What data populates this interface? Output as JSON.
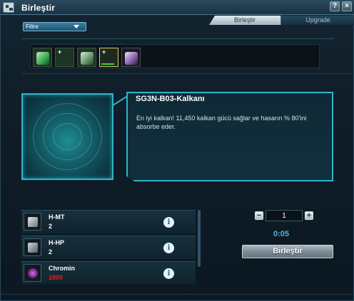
{
  "window": {
    "title": "Birleştir"
  },
  "titlebar": {
    "help_label": "?",
    "close_label": "×"
  },
  "tabs": [
    {
      "label": "Birleştir",
      "active": true
    },
    {
      "label": "Upgrade",
      "active": false
    }
  ],
  "filter": {
    "label": "Filtre"
  },
  "item_strip": {
    "slots": [
      {
        "icon": "green-canister-icon",
        "has_plus": false,
        "selected": false,
        "progress": 0
      },
      {
        "icon": "empty-slot",
        "has_plus": true,
        "selected": false,
        "progress": 0
      },
      {
        "icon": "green-module-icon",
        "has_plus": false,
        "selected": false,
        "progress": 0
      },
      {
        "icon": "empty-slot",
        "has_plus": true,
        "selected": true,
        "progress": 0.8
      },
      {
        "icon": "purple-chip-icon",
        "has_plus": false,
        "selected": false,
        "progress": 0
      }
    ],
    "plus_symbol": "+"
  },
  "selected_item": {
    "name": "SG3N-B03-Kalkanı",
    "description": "En iyi kalkan! 11,450 kalkan gücü sağlar ve hasarın % 80'ini absorbe eder."
  },
  "materials": [
    {
      "name": "H-MT",
      "quantity": "2",
      "sufficient": true,
      "icon": "weapon-part-icon"
    },
    {
      "name": "H-HP",
      "quantity": "2",
      "sufficient": true,
      "icon": "mech-part-icon"
    },
    {
      "name": "Chromin",
      "quantity": "1800",
      "sufficient": false,
      "icon": "chromin-ore-icon"
    }
  ],
  "info_glyph": "i",
  "craft": {
    "minus_label": "−",
    "plus_label": "+",
    "quantity": "1",
    "timer": "0:05",
    "button_label": "Birleştir"
  },
  "colors": {
    "accent": "#2fb4c9",
    "timer": "#4fb8e6",
    "insufficient": "#d8251f"
  }
}
